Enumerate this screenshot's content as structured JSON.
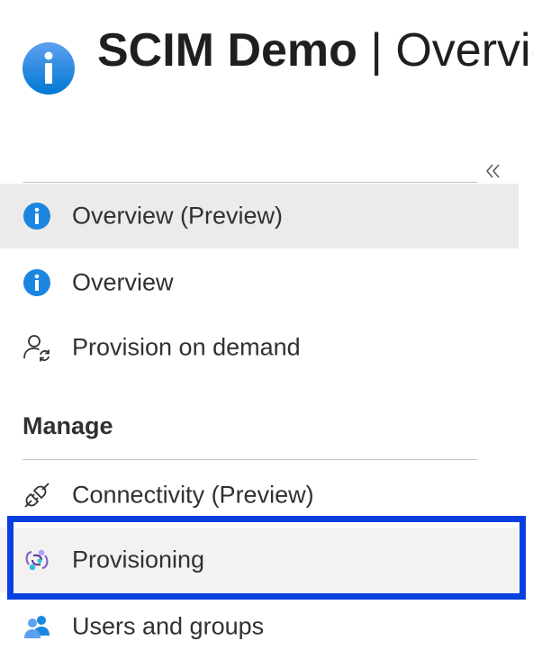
{
  "header": {
    "resource_name": "SCIM Demo",
    "separator": "|",
    "page_name": "Overview",
    "icon": "info-icon"
  },
  "nav": {
    "collapse_icon": "double-chevron-left-icon",
    "items": [
      {
        "label": "Overview (Preview)",
        "icon": "info-icon"
      },
      {
        "label": "Overview",
        "icon": "info-icon"
      },
      {
        "label": "Provision on demand",
        "icon": "person-sync-icon"
      }
    ],
    "manage_section": {
      "label": "Manage",
      "items": [
        {
          "label": "Connectivity (Preview)",
          "icon": "plug-icon"
        },
        {
          "label": "Provisioning",
          "icon": "provisioning-icon"
        },
        {
          "label": "Users and groups",
          "icon": "users-icon"
        }
      ]
    }
  },
  "colors": {
    "info_blue": "#0078d4",
    "selected_bg": "#edebe9",
    "highlight_border": "#0a3fe0"
  }
}
